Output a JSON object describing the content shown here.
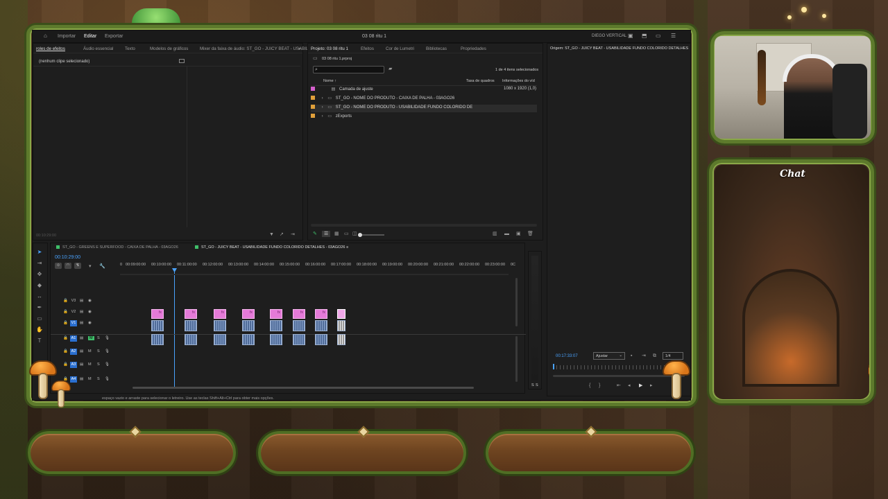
{
  "app": {
    "title": "03 08 ritu 1",
    "menu": [
      "Importar",
      "Editar",
      "Exportar"
    ],
    "workspace": "DIEGO VERTICAL"
  },
  "left_panel": {
    "tabs": [
      "roles de efeitos",
      "Áudio essencial",
      "Texto",
      "Modelos de gráficos",
      "Mixer da faixa de áudio: ST_GO - JUICY BEAT - USABILID"
    ],
    "message": "(nenhum clipe selecionado)",
    "timecode": "00:10:29:00"
  },
  "project_panel": {
    "tabs": [
      "Projeto: 03 08 ritu 1",
      "Efeitos",
      "Cor de Lumetri",
      "Bibliotecas",
      "Propriedades"
    ],
    "project_file": "03 08 ritu 1.prproj",
    "search_placeholder": "",
    "selection_info": "1 de 4 itens selecionados",
    "columns": [
      "Nome",
      "Taxa de quadros",
      "Informações do víd"
    ],
    "items": [
      {
        "name": "Camada de ajuste",
        "color": "#d45fcc",
        "info": "1080 x 1920 (1,0)",
        "folder": false
      },
      {
        "name": "ST_GO - NOME DO PRODUTO - CAIXA DE PALHA - 03AGO26",
        "color": "#e0a03a",
        "info": "",
        "folder": true
      },
      {
        "name": "ST_GO - NOME DO PRODUTO - USABILIDADE FUNDO COLORIDO DE",
        "color": "#e0a03a",
        "info": "",
        "folder": true
      },
      {
        "name": "zExports",
        "color": "#e0a03a",
        "info": "",
        "folder": true
      }
    ]
  },
  "source_panel": {
    "title": "Origem: ST_GO - JUICY BEAT - USABILIDADE FUNDO COLORIDO DETALHES",
    "timecode": "00:17:33:07",
    "fit": "Ajustar",
    "quality": "1/4"
  },
  "timeline": {
    "tabs": [
      "ST_GO - GREENS E SUPERFOOD - CAIXA DE PALHA - 03AGO26",
      "ST_GO - JUICY BEAT - USABILIDADE FUNDO COLORIDO DETALHES - 03AGO26"
    ],
    "timecode": "00:10:29:00",
    "ruler": [
      "0",
      "00:09:00:00",
      "00:10:00:00",
      "00:11:00:00",
      "00:12:00:00",
      "00:13:00:00",
      "00:14:00:00",
      "00:15:00:00",
      "00:16:00:00",
      "00:17:00:00",
      "00:18:00:00",
      "00:19:00:00",
      "00:20:00:00",
      "00:21:00:00",
      "00:22:00:00",
      "00:23:00:00",
      "0C"
    ],
    "video_tracks": [
      "V3",
      "V2",
      "V1"
    ],
    "audio_tracks": [
      "A1",
      "A2",
      "A3",
      "A4"
    ],
    "clip_label": "fx",
    "meter_labels": [
      "S",
      "S"
    ]
  },
  "status_bar": "espaço vazio e arraste para selecionar o letreiro. Use as teclas Shift+Alt+Ctrl para obter mais opções.",
  "overlay": {
    "chat_title": "Chat"
  }
}
